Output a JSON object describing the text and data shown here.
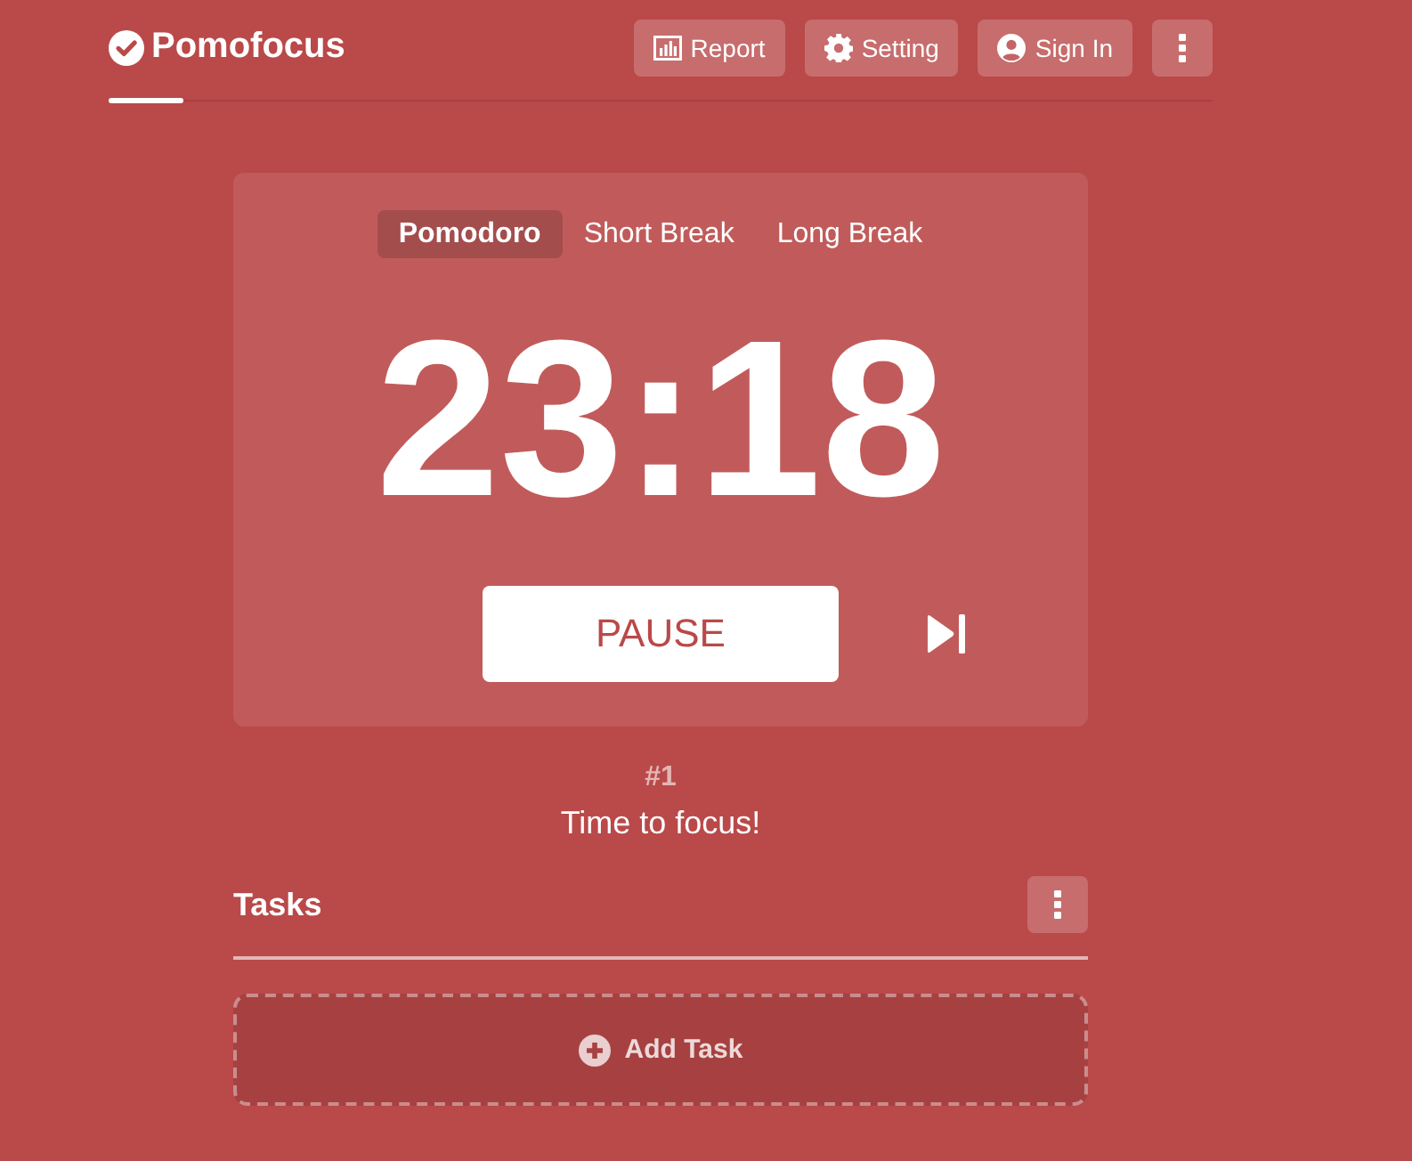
{
  "header": {
    "logo": "Pomofocus",
    "progress": {
      "level": 0.068
    },
    "buttons": [
      {
        "kind": "report",
        "label": "Report"
      },
      {
        "kind": "setting",
        "label": "Setting"
      },
      {
        "kind": "signin",
        "label": "Sign In"
      },
      {
        "kind": "menu"
      }
    ]
  },
  "timer": {
    "modes": [
      {
        "label": "Pomodoro",
        "selected": true
      },
      {
        "label": "Short Break",
        "selected": false
      },
      {
        "label": "Long Break",
        "selected": false
      }
    ],
    "time": "23:18",
    "action": "PAUSE"
  },
  "session": {
    "count": "#1",
    "message": "Time to focus!"
  },
  "tasks": {
    "title": "Tasks",
    "add_label": "Add Task"
  }
}
